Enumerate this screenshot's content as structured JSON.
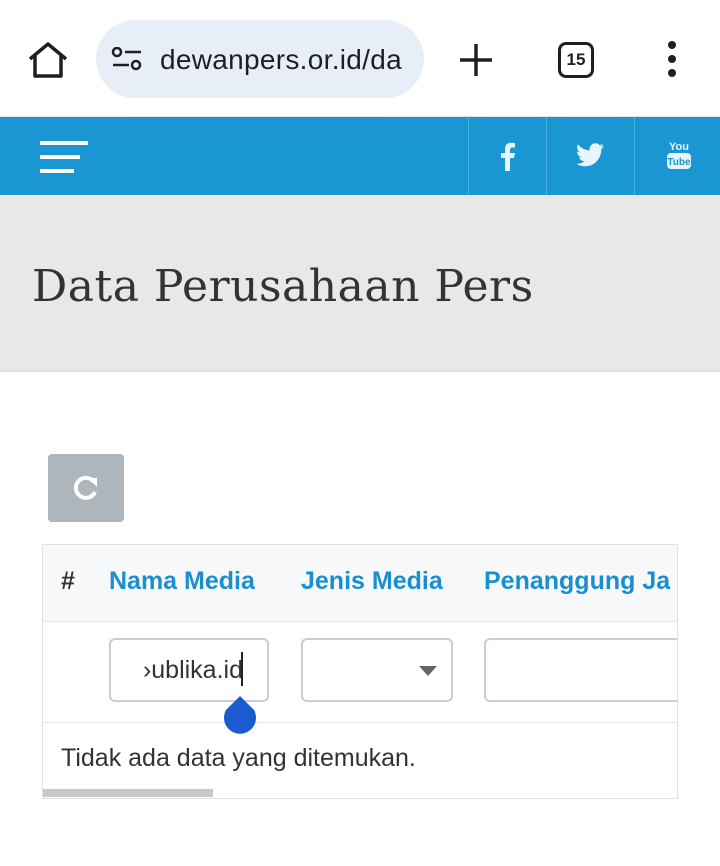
{
  "browser": {
    "url": "dewanpers.or.id/da",
    "tab_count": "15",
    "icons": [
      "home-icon",
      "site-settings-icon",
      "new-tab-icon",
      "tab-switcher-icon",
      "more-menu-icon"
    ]
  },
  "navbar": {
    "color": "#1a96d3",
    "social": [
      "facebook-icon",
      "twitter-icon",
      "youtube-icon"
    ],
    "youtube_text_top": "You",
    "youtube_text_bottom": "Tube"
  },
  "hero": {
    "title": "Data Perusahaan Pers"
  },
  "table": {
    "columns": [
      "#",
      "Nama Media",
      "Jenis Media",
      "Penanggung Ja"
    ],
    "filters": {
      "nama_media_value": "›ublika.id",
      "jenis_media_value": "",
      "penanggung_jawab_value": ""
    },
    "empty_message": "Tidak ada data yang ditemukan."
  }
}
